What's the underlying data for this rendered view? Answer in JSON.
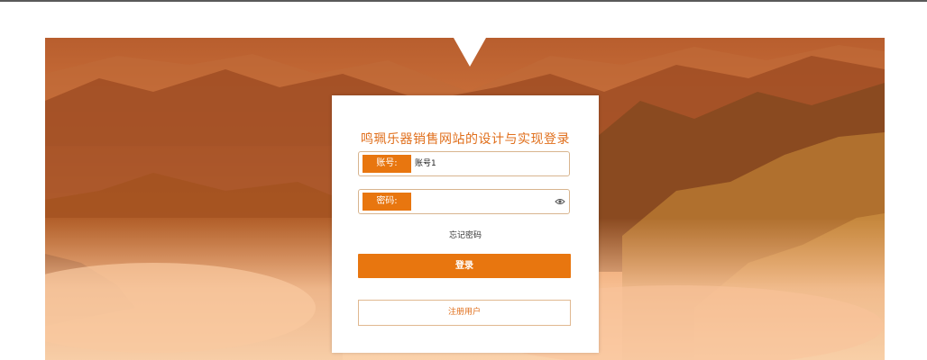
{
  "login": {
    "title": "鸣珮乐器销售网站的设计与实现登录",
    "account_label": "账号:",
    "account_value": "账号1",
    "password_label": "密码:",
    "password_value": "",
    "forgot_password": "忘记密码",
    "login_button": "登录",
    "register_button": "注册用户"
  },
  "icons": {
    "password_visibility": "eye-icon"
  },
  "colors": {
    "accent": "#e8760f",
    "title": "#e06f1c",
    "field_border": "#d8b58f"
  }
}
